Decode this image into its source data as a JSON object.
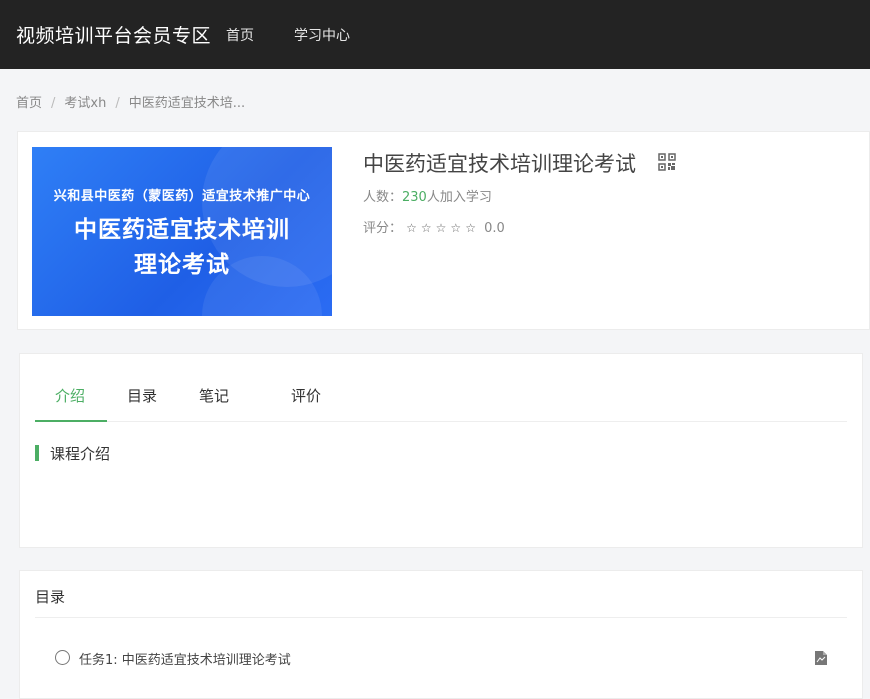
{
  "header": {
    "brand": "视频培训平台会员专区",
    "nav": [
      "首页",
      "学习中心"
    ]
  },
  "breadcrumb": {
    "items": [
      "首页",
      "考试xh",
      "中医药适宜技术培..."
    ],
    "separator": "/"
  },
  "course": {
    "cover": {
      "line1": "兴和县中医药（蒙医药）适宜技术推广中心",
      "line2": "中医药适宜技术培训",
      "line3": "理论考试"
    },
    "title": "中医药适宜技术培训理论考试",
    "learners_label": "人数：",
    "learners_count": "230",
    "learners_suffix": "人加入学习",
    "rating_label": "评分：",
    "stars": "☆☆☆☆☆",
    "rating_value": "0.0"
  },
  "tabs": {
    "items": [
      "介绍",
      "目录",
      "笔记",
      "评价"
    ],
    "active": "介绍",
    "section_title": "课程介绍"
  },
  "catalog": {
    "title": "目录",
    "tasks": [
      {
        "label": "任务1:   中医药适宜技术培训理论考试",
        "icon": "document-icon"
      }
    ]
  },
  "colors": {
    "accent": "#4cae64",
    "topbar": "#232323",
    "background": "#f4f5f7"
  }
}
